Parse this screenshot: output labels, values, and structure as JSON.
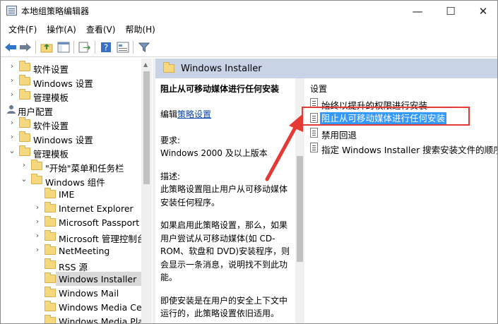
{
  "window": {
    "title": "本地组策略编辑器",
    "controls": {
      "minimize": "—",
      "maximize": "☐",
      "close": "✕"
    }
  },
  "menu": [
    "文件(F)",
    "操作(A)",
    "查看(V)",
    "帮助(H)"
  ],
  "toolbar_icons": [
    "back-arrow-icon",
    "forward-arrow-icon",
    "up-folder-icon",
    "show-tree-icon",
    "export-icon",
    "help-icon",
    "properties-icon",
    "filter-icon"
  ],
  "tree": [
    {
      "label": "软件设置",
      "type": "folder",
      "arrow": "›",
      "indent": 1
    },
    {
      "label": "Windows 设置",
      "type": "folder",
      "arrow": "›",
      "indent": 1
    },
    {
      "label": "管理模板",
      "type": "folder",
      "arrow": "›",
      "indent": 1
    },
    {
      "label": "用户配置",
      "type": "user",
      "arrow": "",
      "indent": 0
    },
    {
      "label": "软件设置",
      "type": "folder",
      "arrow": "›",
      "indent": 1
    },
    {
      "label": "Windows 设置",
      "type": "folder",
      "arrow": "›",
      "indent": 1
    },
    {
      "label": "管理模板",
      "type": "folder",
      "arrow": "⌄",
      "indent": 1
    },
    {
      "label": "\"开始\"菜单和任务栏",
      "type": "folder",
      "arrow": "›",
      "indent": 2
    },
    {
      "label": "Windows 组件",
      "type": "folder",
      "arrow": "⌄",
      "indent": 2
    },
    {
      "label": "IME",
      "type": "folder",
      "arrow": "",
      "indent": 3
    },
    {
      "label": "Internet Explorer",
      "type": "folder",
      "arrow": "›",
      "indent": 3
    },
    {
      "label": "Microsoft Passport",
      "type": "folder",
      "arrow": "›",
      "indent": 3
    },
    {
      "label": "Microsoft 管理控制台",
      "type": "folder",
      "arrow": "›",
      "indent": 3
    },
    {
      "label": "NetMeeting",
      "type": "folder",
      "arrow": "›",
      "indent": 3
    },
    {
      "label": "RSS 源",
      "type": "folder",
      "arrow": "",
      "indent": 3
    },
    {
      "label": "Windows Installer",
      "type": "folder",
      "arrow": "",
      "indent": 3,
      "selected": true
    },
    {
      "label": "Windows Mail",
      "type": "folder",
      "arrow": "",
      "indent": 3
    },
    {
      "label": "Windows Media Ce",
      "type": "folder",
      "arrow": "",
      "indent": 3
    },
    {
      "label": "Windows Media Pla",
      "type": "folder",
      "arrow": "",
      "indent": 3
    }
  ],
  "right": {
    "header_title": "Windows Installer",
    "desc": {
      "policy_title": "阻止从可移动媒体进行任何安装",
      "edit_prefix": "编辑",
      "edit_link": "策略设置",
      "req_label": "要求:",
      "req_value": "Windows 2000 及以上版本",
      "desc_label": "描述:",
      "desc_text": "此策略设置阻止用户从可移动媒体安装任何程序。",
      "para2": "如果启用此策略设置，那么，如果用户尝试从可移动媒体(如 CD-ROM、软盘和 DVD)安装程序，则会显示一条消息，说明找不到此功能。",
      "para3": "即使安装是在用户的安全上下文中运行的，此策略设置依旧适用。"
    },
    "settings_header": "设置",
    "settings": [
      {
        "label": "始终以提升的权限进行安装",
        "selected": false
      },
      {
        "label": "阻止从可移动媒体进行任何安装",
        "selected": true
      },
      {
        "label": "禁用回退",
        "selected": false
      },
      {
        "label": "指定 Windows Installer 搜索安装文件的顺序",
        "selected": false
      }
    ]
  },
  "colors": {
    "header_bg": "#c8d4e6",
    "selection_bg": "#3399ff",
    "annotation": "#e53935",
    "link": "#0645ad"
  }
}
